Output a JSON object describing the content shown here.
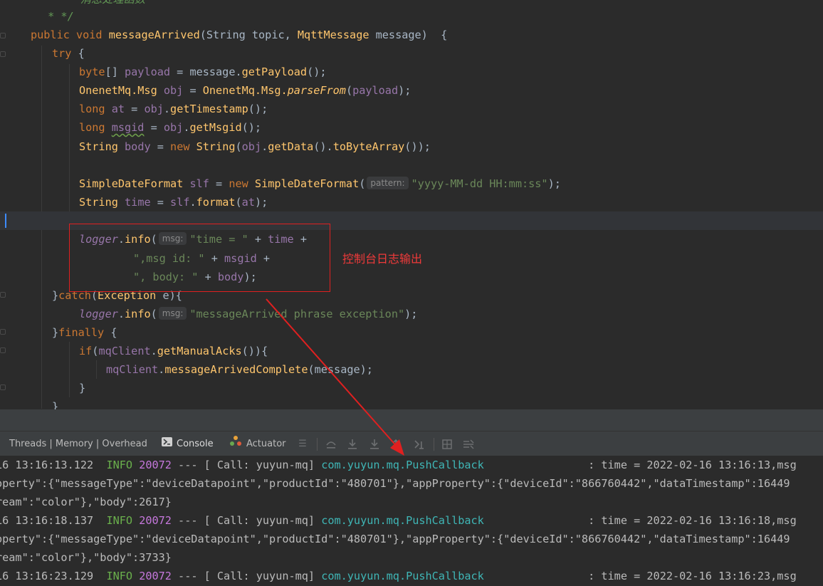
{
  "editor": {
    "lines": [
      {
        "tokens": [
          {
            "t": "c",
            "v": "* "
          },
          {
            "t": "c",
            "v": "    消息处理函数"
          }
        ]
      },
      {
        "tokens": [
          {
            "t": "c",
            "v": " * */"
          }
        ]
      },
      {
        "tokens": [
          {
            "t": "k",
            "v": "public void "
          },
          {
            "t": "m",
            "v": "messageArrived"
          },
          {
            "t": "d",
            "v": "(String topic, "
          },
          {
            "t": "m",
            "v": "MqttMessage"
          },
          {
            "t": "d",
            "v": " message)  {"
          }
        ]
      },
      {
        "tokens": [
          {
            "t": "k",
            "v": "try "
          },
          {
            "t": "d",
            "v": "{"
          }
        ]
      },
      {
        "tokens": [
          {
            "t": "k",
            "v": "byte"
          },
          {
            "t": "d",
            "v": "[] "
          },
          {
            "t": "f",
            "v": "payload"
          },
          {
            "t": "d",
            "v": " = message."
          },
          {
            "t": "m",
            "v": "getPayload"
          },
          {
            "t": "d",
            "v": "();"
          }
        ]
      },
      {
        "tokens": [
          {
            "t": "m",
            "v": "OnenetMq.Msg"
          },
          {
            "t": "d",
            "v": " "
          },
          {
            "t": "f",
            "v": "obj"
          },
          {
            "t": "d",
            "v": " = "
          },
          {
            "t": "m",
            "v": "OnenetMq.Msg."
          },
          {
            "t": "si",
            "v": "parseFrom"
          },
          {
            "t": "d",
            "v": "("
          },
          {
            "t": "f",
            "v": "payload"
          },
          {
            "t": "d",
            "v": ");"
          }
        ]
      },
      {
        "tokens": [
          {
            "t": "k",
            "v": "long "
          },
          {
            "t": "f",
            "v": "at"
          },
          {
            "t": "d",
            "v": " = "
          },
          {
            "t": "f",
            "v": "obj"
          },
          {
            "t": "d",
            "v": "."
          },
          {
            "t": "m",
            "v": "getTimestamp"
          },
          {
            "t": "d",
            "v": "();"
          }
        ]
      },
      {
        "tokens": [
          {
            "t": "k",
            "v": "long "
          },
          {
            "t": "fw",
            "v": "msgid"
          },
          {
            "t": "d",
            "v": " = "
          },
          {
            "t": "f",
            "v": "obj"
          },
          {
            "t": "d",
            "v": "."
          },
          {
            "t": "m",
            "v": "getMsgid"
          },
          {
            "t": "d",
            "v": "();"
          }
        ]
      },
      {
        "tokens": [
          {
            "t": "m",
            "v": "String"
          },
          {
            "t": "d",
            "v": " "
          },
          {
            "t": "f",
            "v": "body"
          },
          {
            "t": "d",
            "v": " = "
          },
          {
            "t": "k",
            "v": "new "
          },
          {
            "t": "m",
            "v": "String"
          },
          {
            "t": "d",
            "v": "("
          },
          {
            "t": "f",
            "v": "obj"
          },
          {
            "t": "d",
            "v": "."
          },
          {
            "t": "m",
            "v": "getData"
          },
          {
            "t": "d",
            "v": "()."
          },
          {
            "t": "m",
            "v": "toByteArray"
          },
          {
            "t": "d",
            "v": "());"
          }
        ]
      },
      {
        "tokens": []
      },
      {
        "tokens": [
          {
            "t": "m",
            "v": "SimpleDateFormat"
          },
          {
            "t": "d",
            "v": " "
          },
          {
            "t": "f",
            "v": "slf"
          },
          {
            "t": "d",
            "v": " = "
          },
          {
            "t": "k",
            "v": "new "
          },
          {
            "t": "m",
            "v": "SimpleDateFormat"
          },
          {
            "t": "d",
            "v": "("
          },
          {
            "t": "h",
            "v": "pattern:"
          },
          {
            "t": "s",
            "v": "\"yyyy-MM-dd HH:mm:ss\""
          },
          {
            "t": "d",
            "v": ");"
          }
        ]
      },
      {
        "tokens": [
          {
            "t": "m",
            "v": "String"
          },
          {
            "t": "d",
            "v": " "
          },
          {
            "t": "f",
            "v": "time"
          },
          {
            "t": "d",
            "v": " = "
          },
          {
            "t": "f",
            "v": "slf"
          },
          {
            "t": "d",
            "v": "."
          },
          {
            "t": "m",
            "v": "format"
          },
          {
            "t": "d",
            "v": "("
          },
          {
            "t": "f",
            "v": "at"
          },
          {
            "t": "d",
            "v": ");"
          }
        ]
      },
      {
        "tokens": []
      },
      {
        "tokens": [
          {
            "t": "fi",
            "v": "logger"
          },
          {
            "t": "d",
            "v": "."
          },
          {
            "t": "m",
            "v": "info"
          },
          {
            "t": "d",
            "v": "("
          },
          {
            "t": "h",
            "v": "msg:"
          },
          {
            "t": "s",
            "v": "\"time = \""
          },
          {
            "t": "d",
            "v": " + "
          },
          {
            "t": "f",
            "v": "time"
          },
          {
            "t": "d",
            "v": " +"
          }
        ]
      },
      {
        "tokens": [
          {
            "t": "s",
            "v": "\",msg id: \""
          },
          {
            "t": "d",
            "v": " + "
          },
          {
            "t": "f",
            "v": "msgid"
          },
          {
            "t": "d",
            "v": " +"
          }
        ]
      },
      {
        "tokens": [
          {
            "t": "s",
            "v": "\", body: \""
          },
          {
            "t": "d",
            "v": " + "
          },
          {
            "t": "f",
            "v": "body"
          },
          {
            "t": "d",
            "v": ");"
          }
        ]
      },
      {
        "tokens": [
          {
            "t": "d",
            "v": "}"
          },
          {
            "t": "k",
            "v": "catch"
          },
          {
            "t": "d",
            "v": "("
          },
          {
            "t": "m",
            "v": "Exception"
          },
          {
            "t": "d",
            "v": " e){"
          }
        ]
      },
      {
        "tokens": [
          {
            "t": "fi",
            "v": "logger"
          },
          {
            "t": "d",
            "v": "."
          },
          {
            "t": "m",
            "v": "info"
          },
          {
            "t": "d",
            "v": "("
          },
          {
            "t": "h",
            "v": "msg:"
          },
          {
            "t": "s",
            "v": "\"messageArrived phrase exception\""
          },
          {
            "t": "d",
            "v": ");"
          }
        ]
      },
      {
        "tokens": [
          {
            "t": "d",
            "v": "}"
          },
          {
            "t": "k",
            "v": "finally "
          },
          {
            "t": "d",
            "v": "{"
          }
        ]
      },
      {
        "tokens": [
          {
            "t": "k",
            "v": "if"
          },
          {
            "t": "d",
            "v": "("
          },
          {
            "t": "f",
            "v": "mqClient"
          },
          {
            "t": "d",
            "v": "."
          },
          {
            "t": "m",
            "v": "getManualAcks"
          },
          {
            "t": "d",
            "v": "()){"
          }
        ]
      },
      {
        "tokens": [
          {
            "t": "f",
            "v": "mqClient"
          },
          {
            "t": "d",
            "v": "."
          },
          {
            "t": "m",
            "v": "messageArrivedComplete"
          },
          {
            "t": "d",
            "v": "(message);"
          }
        ]
      },
      {
        "tokens": [
          {
            "t": "d",
            "v": "}"
          }
        ]
      },
      {
        "tokens": [
          {
            "t": "d",
            "v": "}"
          }
        ]
      }
    ],
    "annotation": "控制台日志输出"
  },
  "toolbar": {
    "tab_threads": "Threads | Memory | Overhead",
    "tab_console": "Console",
    "tab_actuator": "Actuator"
  },
  "console": {
    "lines": [
      {
        "segs": [
          {
            "t": "p",
            "v": "16 13:16:13.122  "
          },
          {
            "t": "info",
            "v": "INFO"
          },
          {
            "t": "p",
            "v": " "
          },
          {
            "t": "pid",
            "v": "20072"
          },
          {
            "t": "p",
            "v": " --- [ Call: yuyun-mq] "
          },
          {
            "t": "cls",
            "v": "com.yuyun.mq.PushCallback"
          },
          {
            "t": "p",
            "v": "                : time = 2022-02-16 13:16:13,msg"
          }
        ]
      },
      {
        "segs": [
          {
            "t": "p",
            "v": "operty\":{\"messageType\":\"deviceDatapoint\",\"productId\":\"480701\"},\"appProperty\":{\"deviceId\":\"866760442\",\"dataTimestamp\":16449"
          }
        ]
      },
      {
        "segs": [
          {
            "t": "p",
            "v": "ream\":\"color\"},\"body\":2617}"
          }
        ]
      },
      {
        "segs": [
          {
            "t": "p",
            "v": "16 13:16:18.137  "
          },
          {
            "t": "info",
            "v": "INFO"
          },
          {
            "t": "p",
            "v": " "
          },
          {
            "t": "pid",
            "v": "20072"
          },
          {
            "t": "p",
            "v": " --- [ Call: yuyun-mq] "
          },
          {
            "t": "cls",
            "v": "com.yuyun.mq.PushCallback"
          },
          {
            "t": "p",
            "v": "                : time = 2022-02-16 13:16:18,msg"
          }
        ]
      },
      {
        "segs": [
          {
            "t": "p",
            "v": "operty\":{\"messageType\":\"deviceDatapoint\",\"productId\":\"480701\"},\"appProperty\":{\"deviceId\":\"866760442\",\"dataTimestamp\":16449"
          }
        ]
      },
      {
        "segs": [
          {
            "t": "p",
            "v": "ream\":\"color\"},\"body\":3733}"
          }
        ]
      },
      {
        "segs": [
          {
            "t": "p",
            "v": "16 13:16:23.129  "
          },
          {
            "t": "info",
            "v": "INFO"
          },
          {
            "t": "p",
            "v": " "
          },
          {
            "t": "pid",
            "v": "20072"
          },
          {
            "t": "p",
            "v": " --- [ Call: yuyun-mq] "
          },
          {
            "t": "cls",
            "v": "com.yuyun.mq.PushCallback"
          },
          {
            "t": "p",
            "v": "                : time = 2022-02-16 13:16:23,msg"
          }
        ]
      }
    ]
  }
}
